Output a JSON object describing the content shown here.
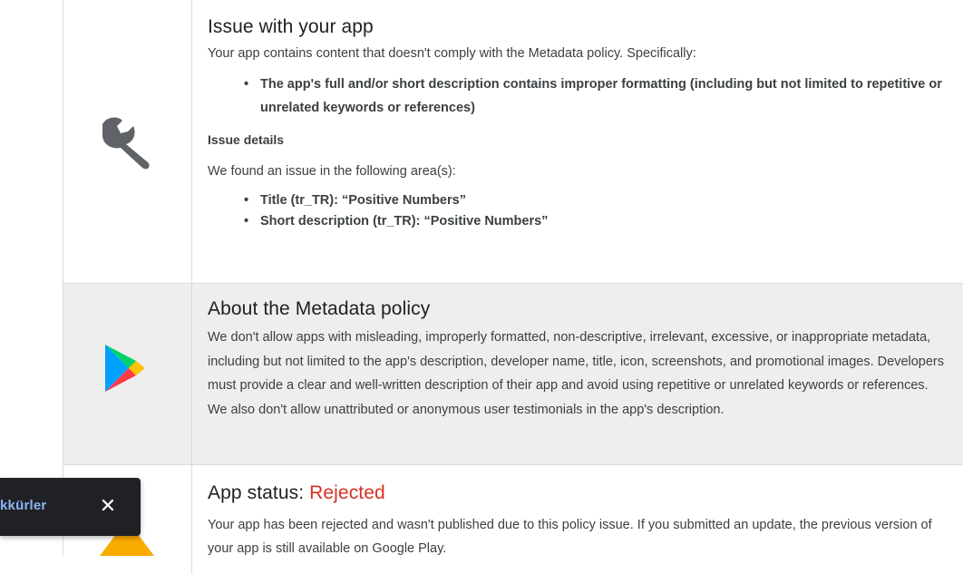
{
  "issue": {
    "title": "Issue with your app",
    "intro": "Your app contains content that doesn't comply with the Metadata policy. Specifically:",
    "bullet": "The app's full and/or short description contains improper formatting (including but not limited to repetitive or unrelated keywords or references)",
    "details_heading": "Issue details",
    "areas_intro": "We found an issue in the following area(s):",
    "areas": [
      {
        "label": "Title (tr_TR)",
        "value": ": “Positive Numbers”"
      },
      {
        "label": "Short description (tr_TR)",
        "value": ": “Positive Numbers”"
      }
    ]
  },
  "policy": {
    "title": "About the Metadata policy",
    "body": "We don't allow apps with misleading, improperly formatted, non-descriptive, irrelevant, excessive, or inappropriate metadata, including but not limited to the app's description, developer name, title, icon, screenshots, and promotional images. Developers must provide a clear and well-written description of their app and avoid using repetitive or unrelated keywords or references. We also don't allow unattributed or anonymous user testimonials in the app's description."
  },
  "status": {
    "label": "App status: ",
    "value": "Rejected",
    "body": "Your app has been rejected and wasn't published due to this policy issue. If you submitted an update, the previous version of your app is still available on Google Play."
  },
  "snackbar": {
    "text": "kkürler",
    "close_icon": "close-icon"
  },
  "colors": {
    "rejected": "#d93025",
    "snackbar_link": "#8ab4f8",
    "row_gray": "#eeeeee"
  },
  "icons": [
    "wrench-icon",
    "google-play-icon",
    "warning-icon"
  ]
}
